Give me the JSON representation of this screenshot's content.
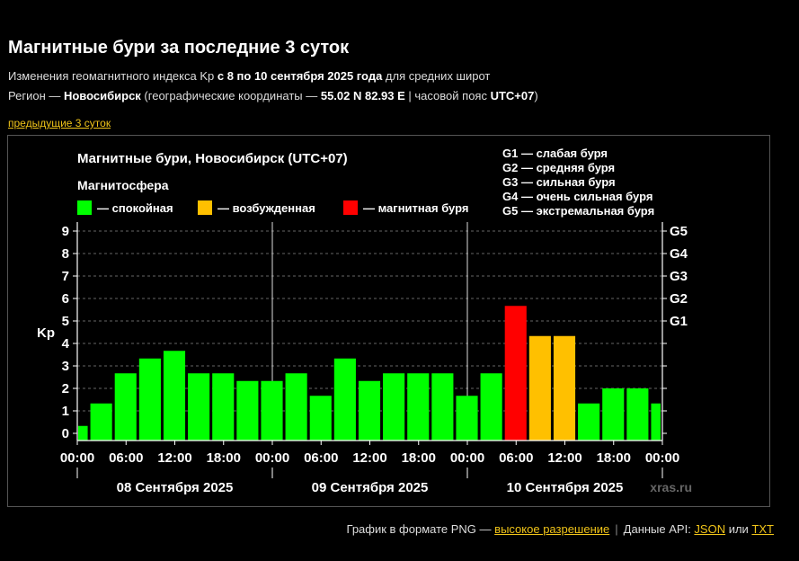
{
  "header": {
    "title": "Магнитные бури за последние 3 суток",
    "line1_pre": "Изменения геомагнитного индекса Kp ",
    "line1_bold": "с 8 по 10 сентября 2025 года",
    "line1_post": " для средних широт",
    "line2_pre": "Регион — ",
    "line2_city": "Новосибирск",
    "line2_mid": " (географические координаты — ",
    "line2_coords": "55.02 N 82.93 E",
    "line2_tz_pre": " | часовой пояс ",
    "line2_tz": "UTC+07",
    "line2_end": ")",
    "prev_link": "предыдущие 3 суток"
  },
  "chart_data": {
    "type": "bar",
    "title": "Магнитные бури, Новосибирск (UTC+07)",
    "legend_title": "Магнитосфера",
    "legend": [
      {
        "label": "— спокойная",
        "color": "#00ff00"
      },
      {
        "label": "— возбужденная",
        "color": "#ffc000"
      },
      {
        "label": "— магнитная буря",
        "color": "#ff0000"
      }
    ],
    "storm_levels": [
      {
        "code": "G1",
        "text": "G1 — слабая буря",
        "kp": 5
      },
      {
        "code": "G2",
        "text": "G2 — средняя буря",
        "kp": 6
      },
      {
        "code": "G3",
        "text": "G3 — сильная буря",
        "kp": 7
      },
      {
        "code": "G4",
        "text": "G4 — очень сильная буря",
        "kp": 8
      },
      {
        "code": "G5",
        "text": "G5 — экстремальная буря",
        "kp": 9
      }
    ],
    "ylabel": "Kp",
    "ylim": [
      0,
      9
    ],
    "yticks": [
      0,
      1,
      2,
      3,
      4,
      5,
      6,
      7,
      8,
      9
    ],
    "xticks": [
      "00:00",
      "06:00",
      "12:00",
      "18:00",
      "00:00",
      "06:00",
      "12:00",
      "18:00",
      "00:00",
      "06:00",
      "12:00",
      "18:00",
      "00:00"
    ],
    "days": [
      "08 Сентября 2025",
      "09 Сентября 2025",
      "10 Сентября 2025"
    ],
    "values": [
      0.33,
      1.33,
      2.67,
      3.33,
      3.67,
      2.67,
      2.67,
      2.33,
      2.33,
      2.67,
      1.67,
      3.33,
      2.33,
      2.67,
      2.67,
      2.67,
      1.67,
      2.67,
      5.67,
      4.33,
      4.33,
      1.33,
      2.0,
      2.0,
      1.33
    ],
    "colors": {
      "quiet": "#00ff00",
      "active": "#ffc000",
      "storm": "#ff0000"
    },
    "watermark": "xras.ru"
  },
  "footer": {
    "png_text": "График в формате PNG — ",
    "hires": "высокое разрешение",
    "sep": "|",
    "api_text": "Данные API: ",
    "json": "JSON",
    "or": " или ",
    "txt": "TXT"
  }
}
